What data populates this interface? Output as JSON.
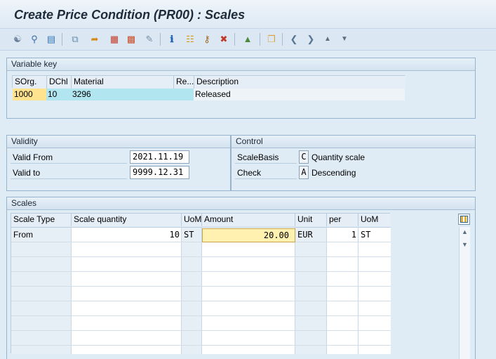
{
  "window": {
    "title": "Create Price Condition (PR00) : Scales"
  },
  "toolbar": {
    "icons": [
      "display-change-icon",
      "where-used-icon",
      "condition-info-icon",
      "copy-icon",
      "export-icon",
      "calendar-icon",
      "gift-icon",
      "edit-icon",
      "info-icon",
      "hierarchy-icon",
      "key-icon",
      "delete-icon",
      "mountain-icon",
      "new-window-icon",
      "prev-page-icon",
      "next-page-icon",
      "up-arrow-icon",
      "down-arrow-icon"
    ]
  },
  "variable_key": {
    "header": "Variable key",
    "columns": [
      "SOrg.",
      "DChl",
      "Material",
      "Re...",
      "Description"
    ],
    "row": {
      "sorg": "1000",
      "dchl": "10",
      "material": "3296",
      "re": "",
      "description": "Released"
    }
  },
  "validity": {
    "header": "Validity",
    "valid_from_label": "Valid From",
    "valid_from": "2021.11.19",
    "valid_to_label": "Valid to",
    "valid_to": "9999.12.31"
  },
  "control": {
    "header": "Control",
    "scale_basis_label": "ScaleBasis",
    "scale_basis_code": "C",
    "scale_basis_text": "Quantity scale",
    "check_label": "Check",
    "check_code": "A",
    "check_text": "Descending"
  },
  "scales": {
    "header": "Scales",
    "columns": [
      "Scale Type",
      "Scale quantity",
      "UoM",
      "Amount",
      "Unit",
      "per",
      "UoM"
    ],
    "row": {
      "scale_type": "From",
      "scale_quantity": "10",
      "uom": "ST",
      "amount": "20.00",
      "unit": "EUR",
      "per": "1",
      "uom2": "ST"
    }
  },
  "colors": {
    "key_highlight": "#ffe38f",
    "row_highlight": "#b1e6f0",
    "amount_highlight": "#fff2b0"
  }
}
